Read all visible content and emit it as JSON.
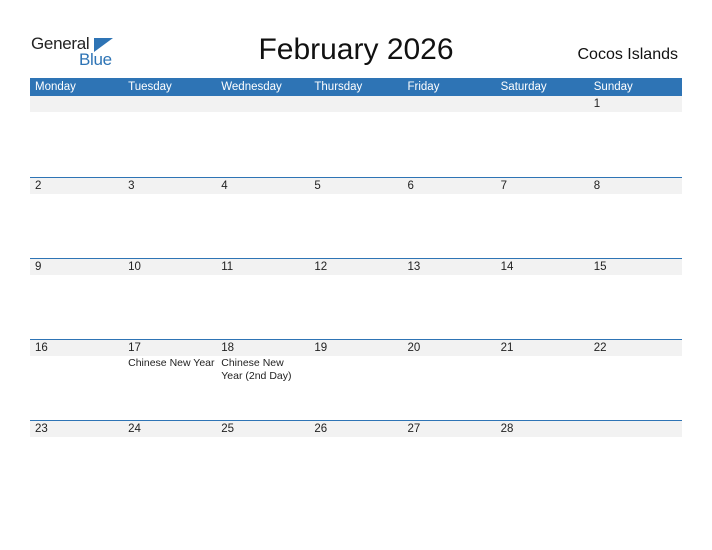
{
  "logo": {
    "word1": "General",
    "word2": "Blue"
  },
  "title": "February 2026",
  "country": "Cocos Islands",
  "colors": {
    "accent": "#2e74b5",
    "strip": "#f2f2f2"
  },
  "weekdays": [
    "Monday",
    "Tuesday",
    "Wednesday",
    "Thursday",
    "Friday",
    "Saturday",
    "Sunday"
  ],
  "weeks": [
    {
      "days": [
        {
          "num": "",
          "holiday": ""
        },
        {
          "num": "",
          "holiday": ""
        },
        {
          "num": "",
          "holiday": ""
        },
        {
          "num": "",
          "holiday": ""
        },
        {
          "num": "",
          "holiday": ""
        },
        {
          "num": "",
          "holiday": ""
        },
        {
          "num": "1",
          "holiday": ""
        }
      ]
    },
    {
      "days": [
        {
          "num": "2",
          "holiday": ""
        },
        {
          "num": "3",
          "holiday": ""
        },
        {
          "num": "4",
          "holiday": ""
        },
        {
          "num": "5",
          "holiday": ""
        },
        {
          "num": "6",
          "holiday": ""
        },
        {
          "num": "7",
          "holiday": ""
        },
        {
          "num": "8",
          "holiday": ""
        }
      ]
    },
    {
      "days": [
        {
          "num": "9",
          "holiday": ""
        },
        {
          "num": "10",
          "holiday": ""
        },
        {
          "num": "11",
          "holiday": ""
        },
        {
          "num": "12",
          "holiday": ""
        },
        {
          "num": "13",
          "holiday": ""
        },
        {
          "num": "14",
          "holiday": ""
        },
        {
          "num": "15",
          "holiday": ""
        }
      ]
    },
    {
      "days": [
        {
          "num": "16",
          "holiday": ""
        },
        {
          "num": "17",
          "holiday": "Chinese New Year"
        },
        {
          "num": "18",
          "holiday": "Chinese New Year (2nd Day)"
        },
        {
          "num": "19",
          "holiday": ""
        },
        {
          "num": "20",
          "holiday": ""
        },
        {
          "num": "21",
          "holiday": ""
        },
        {
          "num": "22",
          "holiday": ""
        }
      ]
    },
    {
      "days": [
        {
          "num": "23",
          "holiday": ""
        },
        {
          "num": "24",
          "holiday": ""
        },
        {
          "num": "25",
          "holiday": ""
        },
        {
          "num": "26",
          "holiday": ""
        },
        {
          "num": "27",
          "holiday": ""
        },
        {
          "num": "28",
          "holiday": ""
        },
        {
          "num": "",
          "holiday": ""
        }
      ]
    }
  ]
}
